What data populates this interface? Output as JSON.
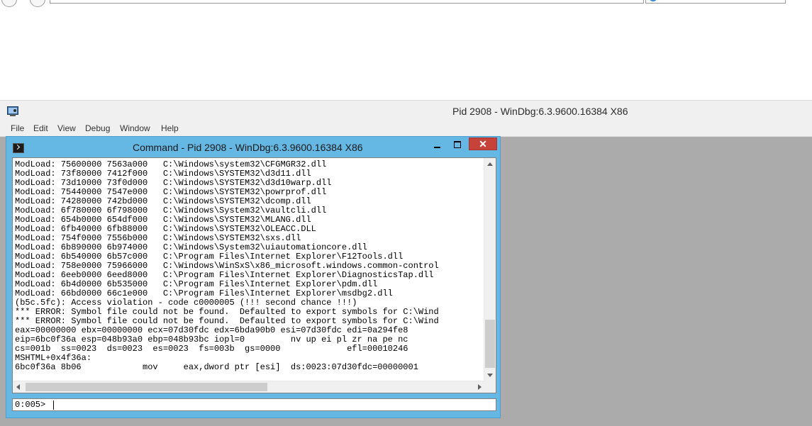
{
  "windbg": {
    "title": "Pid 2908 - WinDbg:6.3.9600.16384 X86",
    "menu": [
      "File",
      "Edit",
      "View",
      "Debug",
      "Window",
      "Help"
    ]
  },
  "command_window": {
    "title": "Command - Pid 2908 - WinDbg:6.3.9600.16384 X86",
    "close_glyph": "✕",
    "prompt": "0:005>",
    "input_value": "",
    "output_lines": [
      "ModLoad: 75600000 7563a000   C:\\Windows\\system32\\CFGMGR32.dll",
      "ModLoad: 73f80000 7412f000   C:\\Windows\\SYSTEM32\\d3d11.dll",
      "ModLoad: 73d10000 73f0d000   C:\\Windows\\SYSTEM32\\d3d10warp.dll",
      "ModLoad: 75440000 7547e000   C:\\Windows\\SYSTEM32\\powrprof.dll",
      "ModLoad: 74280000 742bd000   C:\\Windows\\SYSTEM32\\dcomp.dll",
      "ModLoad: 6f780000 6f798000   C:\\Windows\\System32\\vaultcli.dll",
      "ModLoad: 654b0000 654df000   C:\\Windows\\SYSTEM32\\MLANG.dll",
      "ModLoad: 6fb40000 6fb88000   C:\\Windows\\SYSTEM32\\OLEACC.DLL",
      "ModLoad: 754f0000 7556b000   C:\\Windows\\SYSTEM32\\sxs.dll",
      "ModLoad: 6b890000 6b974000   C:\\Windows\\System32\\uiautomationcore.dll",
      "ModLoad: 6b540000 6b57c000   C:\\Program Files\\Internet Explorer\\F12Tools.dll",
      "ModLoad: 758e0000 75966000   C:\\Windows\\WinSxS\\x86_microsoft.windows.common-control",
      "ModLoad: 6eeb0000 6eed8000   C:\\Program Files\\Internet Explorer\\DiagnosticsTap.dll",
      "ModLoad: 6b4d0000 6b535000   C:\\Program Files\\Internet Explorer\\pdm.dll",
      "ModLoad: 66bd0000 66c1e000   C:\\Program Files\\Internet Explorer\\msdbg2.dll",
      "(b5c.5fc): Access violation - code c0000005 (!!! second chance !!!)",
      "*** ERROR: Symbol file could not be found.  Defaulted to export symbols for C:\\Wind",
      "*** ERROR: Symbol file could not be found.  Defaulted to export symbols for C:\\Wind",
      "eax=00000000 ebx=00000000 ecx=07d30fdc edx=6bda90b0 esi=07d30fdc edi=0a294fe8",
      "eip=6bc0f36a esp=048b93a0 ebp=048b93bc iopl=0         nv up ei pl zr na pe nc",
      "cs=001b  ss=0023  ds=0023  es=0023  fs=003b  gs=0000             efl=00010246",
      "MSHTML+0x4f36a:",
      "6bc0f36a 8b06            mov     eax,dword ptr [esi]  ds:0023:07d30fdc=00000001"
    ]
  },
  "colors": {
    "child_frame": "#65b7e4",
    "close_button": "#c7433a",
    "mdi_background": "#ababab"
  }
}
